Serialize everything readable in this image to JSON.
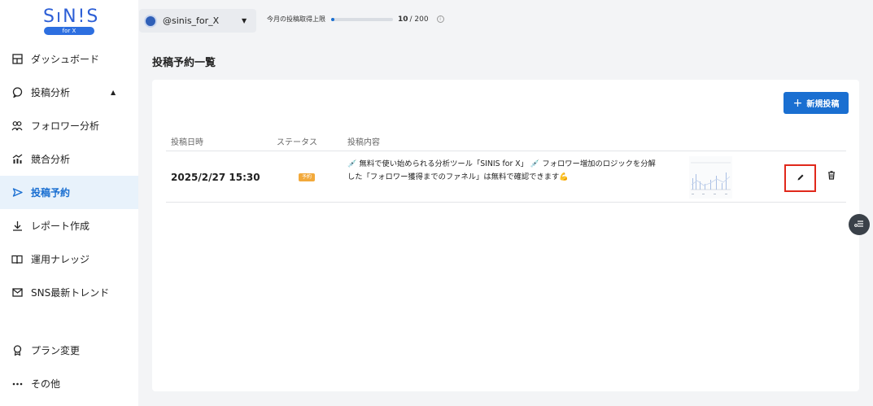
{
  "logo": {
    "main": "SıN!S",
    "sub": "for X"
  },
  "sidebar": {
    "items": [
      {
        "label": "ダッシュボード",
        "icon": "dashboard-icon"
      },
      {
        "label": "投稿分析",
        "icon": "chat-bubble-icon"
      },
      {
        "label": "フォロワー分析",
        "icon": "users-icon"
      },
      {
        "label": "競合分析",
        "icon": "chart-icon"
      },
      {
        "label": "投稿予約",
        "icon": "send-icon"
      },
      {
        "label": "レポート作成",
        "icon": "download-icon"
      },
      {
        "label": "運用ナレッジ",
        "icon": "book-icon"
      },
      {
        "label": "SNS最新トレンド",
        "icon": "mail-icon"
      }
    ],
    "bottom": [
      {
        "label": "プラン変更",
        "icon": "badge-icon"
      },
      {
        "label": "その他",
        "icon": "more-icon"
      }
    ]
  },
  "account": {
    "name": "@sinis_for_X"
  },
  "quota": {
    "label": "今月の投稿取得上限",
    "used": "10",
    "total": "/ 200",
    "fill": 0.05
  },
  "page": {
    "title": "投稿予約一覧"
  },
  "new_post": {
    "label": "新規投稿"
  },
  "table": {
    "headers": [
      "投稿日時",
      "ステータス",
      "投稿内容"
    ],
    "rows": [
      {
        "date": "2025/2/27 15:30",
        "status": "予約",
        "line1": "💉 無料で使い始められる分析ツール「SINIS for X」 💉 フォロワー増加のロジックを分解",
        "line2": "した「フォロワー獲得までのファネル」は無料で確認できます💪"
      }
    ]
  },
  "colors": {
    "accent": "#1a6fd1",
    "highlight": "#e0281b",
    "badge": "#f2a93b"
  }
}
